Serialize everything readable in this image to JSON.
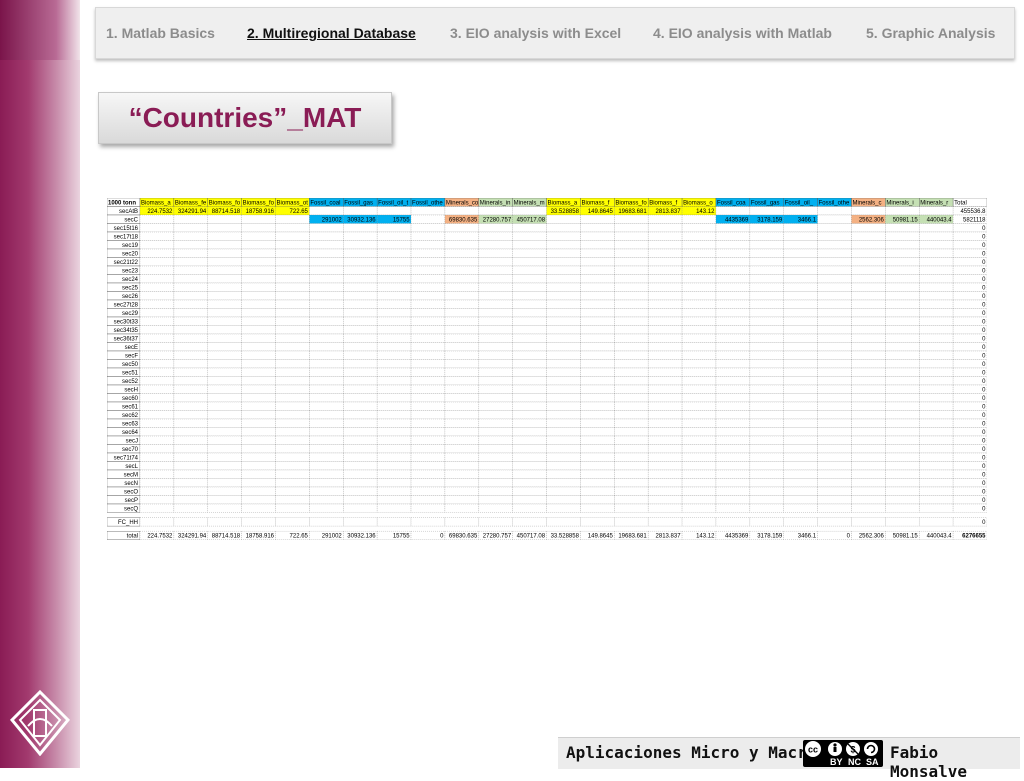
{
  "tabs": [
    {
      "label": "1. Matlab Basics",
      "active": false
    },
    {
      "label": "2. Multiregional Database",
      "active": true
    },
    {
      "label": "3. EIO analysis with Excel",
      "active": false
    },
    {
      "label": "4. EIO analysis with Matlab",
      "active": false
    },
    {
      "label": "5. Graphic Analysis",
      "active": false
    }
  ],
  "slide_title": "“Countries”_MAT",
  "footer": {
    "left_text": "Aplicaciones Micro y Macro",
    "right_text": "Fabio Monsalve",
    "cc_badges": [
      "BY",
      "NC",
      "SA"
    ]
  },
  "colors": {
    "accent": "#8a1c55",
    "yellow": "#ffff00",
    "blue": "#00b0f0",
    "salmon": "#f4b183",
    "green": "#c5e0b4"
  },
  "sheet": {
    "corner": "1000 tonn",
    "headers": [
      {
        "label": "Biomass_a",
        "color": "yellow"
      },
      {
        "label": "Biomass_fe",
        "color": "yellow"
      },
      {
        "label": "Biomass_fo",
        "color": "yellow"
      },
      {
        "label": "Biomass_fo",
        "color": "yellow"
      },
      {
        "label": "Biomass_ot",
        "color": "yellow"
      },
      {
        "label": "Fossil_coal",
        "color": "blue"
      },
      {
        "label": "Fossil_gas",
        "color": "blue"
      },
      {
        "label": "Fossil_oil_t",
        "color": "blue"
      },
      {
        "label": "Fossil_othe",
        "color": "blue"
      },
      {
        "label": "Minerals_co",
        "color": "salmon"
      },
      {
        "label": "Minerals_in",
        "color": "green"
      },
      {
        "label": "Minerals_m",
        "color": "green"
      },
      {
        "label": "Biomass_a",
        "color": "yellow"
      },
      {
        "label": "Biomass_f",
        "color": "yellow"
      },
      {
        "label": "Biomass_fo",
        "color": "yellow"
      },
      {
        "label": "Biomass_f",
        "color": "yellow"
      },
      {
        "label": "Biomass_o",
        "color": "yellow"
      },
      {
        "label": "Fossil_coa",
        "color": "blue"
      },
      {
        "label": "Fossil_gas",
        "color": "blue"
      },
      {
        "label": "Fossil_oil_",
        "color": "blue"
      },
      {
        "label": "Fossil_othe",
        "color": "blue"
      },
      {
        "label": "Minerals_c",
        "color": "salmon"
      },
      {
        "label": "Minerals_i",
        "color": "green"
      },
      {
        "label": "Minerals_r",
        "color": "green"
      },
      {
        "label": "Total",
        "color": "none"
      }
    ],
    "rows": [
      {
        "label": "secAtB",
        "cells": {
          "0": "224.7532",
          "1": "324291.94",
          "2": "88714.518",
          "3": "18758.916",
          "4": "722.65",
          "12": "33.528858",
          "13": "149.8645",
          "14": "19683.681",
          "15": "2813.837",
          "16": "143.12",
          "24": "455536.8"
        }
      },
      {
        "label": "secC",
        "cells": {
          "5": "291002",
          "6": "30932.136",
          "7": "15755",
          "9": "69830.635",
          "10": "27280.757",
          "11": "450717.08",
          "17": "4435369",
          "18": "3178.159",
          "19": "3466.1",
          "21": "2562.306",
          "22": "50981.15",
          "23": "440043.4",
          "24": "5821118"
        }
      },
      {
        "label": "sec15t16",
        "total": "0"
      },
      {
        "label": "sec17t18",
        "total": "0"
      },
      {
        "label": "sec19",
        "total": "0"
      },
      {
        "label": "sec20",
        "total": "0"
      },
      {
        "label": "sec21t22",
        "total": "0"
      },
      {
        "label": "sec23",
        "total": "0"
      },
      {
        "label": "sec24",
        "total": "0"
      },
      {
        "label": "sec25",
        "total": "0"
      },
      {
        "label": "sec26",
        "total": "0"
      },
      {
        "label": "sec27t28",
        "total": "0"
      },
      {
        "label": "sec29",
        "total": "0"
      },
      {
        "label": "sec30t33",
        "total": "0"
      },
      {
        "label": "sec34t35",
        "total": "0"
      },
      {
        "label": "sec36t37",
        "total": "0"
      },
      {
        "label": "secE",
        "total": "0"
      },
      {
        "label": "secF",
        "total": "0"
      },
      {
        "label": "sec50",
        "total": "0"
      },
      {
        "label": "sec51",
        "total": "0"
      },
      {
        "label": "sec52",
        "total": "0"
      },
      {
        "label": "secH",
        "total": "0"
      },
      {
        "label": "sec60",
        "total": "0"
      },
      {
        "label": "sec61",
        "total": "0"
      },
      {
        "label": "sec62",
        "total": "0"
      },
      {
        "label": "sec63",
        "total": "0"
      },
      {
        "label": "sec64",
        "total": "0"
      },
      {
        "label": "secJ",
        "total": "0"
      },
      {
        "label": "sec70",
        "total": "0"
      },
      {
        "label": "sec71t74",
        "total": "0"
      },
      {
        "label": "secL",
        "total": "0"
      },
      {
        "label": "secM",
        "total": "0"
      },
      {
        "label": "secN",
        "total": "0"
      },
      {
        "label": "secO",
        "total": "0"
      },
      {
        "label": "secP",
        "total": "0"
      },
      {
        "label": "secQ",
        "total": "0"
      }
    ],
    "fc_row": {
      "label": "FC_HH",
      "total": "0"
    },
    "total_row": {
      "label": "total",
      "values": [
        "224.7532",
        "324291.94",
        "88714.518",
        "18758.916",
        "722.65",
        "291002",
        "30932.136",
        "15755",
        "0",
        "69830.635",
        "27280.757",
        "450717.08",
        "33.528858",
        "149.8645",
        "19683.681",
        "2813.837",
        "143.12",
        "4435369",
        "3178.159",
        "3466.1",
        "0",
        "2562.306",
        "50981.15",
        "440043.4",
        "6276655"
      ]
    }
  }
}
